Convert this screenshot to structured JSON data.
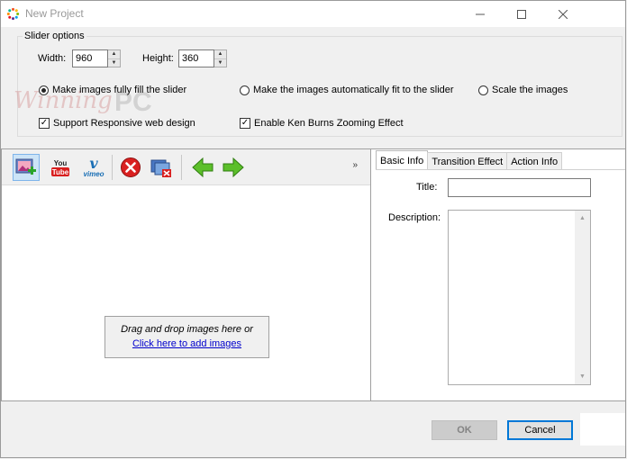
{
  "window": {
    "title": "New Project"
  },
  "slider_options": {
    "group_title": "Slider options",
    "width_label": "Width:",
    "width_value": "960",
    "height_label": "Height:",
    "height_value": "360",
    "fit_modes": [
      {
        "label": "Make images fully fill the slider",
        "selected": true
      },
      {
        "label": "Make the images automatically fit to the slider",
        "selected": false
      },
      {
        "label": "Scale the images",
        "selected": false
      }
    ],
    "responsive": {
      "label": "Support Responsive web design",
      "checked": true
    },
    "ken_burns": {
      "label": "Enable Ken Burns Zooming Effect",
      "checked": true
    }
  },
  "watermark": {
    "part1": "Winning",
    "part2": "PC"
  },
  "toolbar": {
    "icons": [
      "add-image-icon",
      "youtube-icon",
      "vimeo-icon",
      "delete-icon",
      "remove-all-icon",
      "move-left-icon",
      "move-right-icon"
    ],
    "youtube_text": {
      "you": "You",
      "tube": "Tube"
    },
    "vimeo_text": {
      "v": "v",
      "word": "vimeo"
    },
    "overflow": "»"
  },
  "drop_zone": {
    "text": "Drag and drop images here or",
    "link": "Click here to add images"
  },
  "tabs": [
    {
      "label": "Basic Info",
      "active": true
    },
    {
      "label": "Transition Effect",
      "active": false
    },
    {
      "label": "Action Info",
      "active": false
    }
  ],
  "basic_info": {
    "title_label": "Title:",
    "title_value": "",
    "description_label": "Description:",
    "description_value": ""
  },
  "buttons": {
    "ok": "OK",
    "cancel": "Cancel"
  },
  "colors": {
    "accent": "#0078d7",
    "link": "#0000cc"
  }
}
